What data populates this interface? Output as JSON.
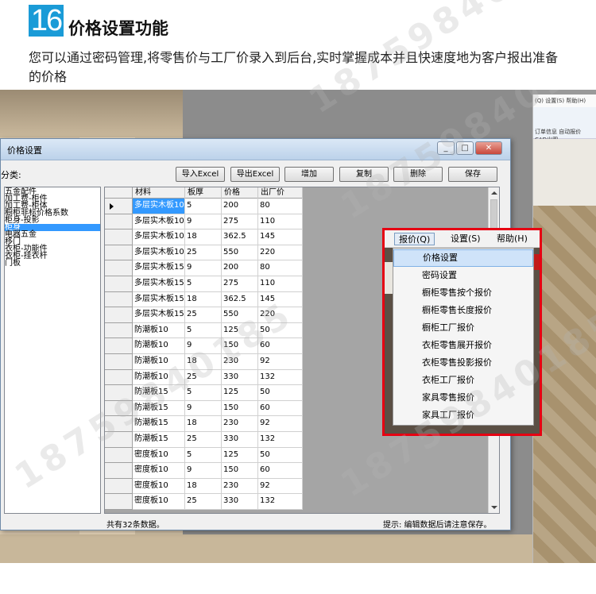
{
  "header": {
    "number": "16",
    "title": "价格设置功能",
    "description": "您可以通过密码管理,将零售价与工厂价录入到后台,实时掌握成本并且快速度地为客户报出准备的价格"
  },
  "window": {
    "title": "价格设置",
    "controls": [
      "_",
      "□",
      "✕"
    ],
    "category_label": "分类:",
    "buttons": {
      "import": "导入Excel",
      "export": "导出Excel",
      "add": "增加",
      "copy": "复制",
      "delete": "删除",
      "save": "保存"
    },
    "tree": [
      "五金配件",
      "加工费-柜件",
      "加工费-柜体",
      "橱柜非标价格系数",
      "柜身-投影",
      "柜身",
      "电器五金",
      "移门",
      "衣柜-功能件",
      "衣柜-挂衣杆",
      "门板"
    ],
    "tree_selected_index": 5,
    "columns": [
      "材料",
      "板厚",
      "价格",
      "出厂价"
    ],
    "rows": [
      [
        "多层实木板10",
        "5",
        "200",
        "80"
      ],
      [
        "多层实木板10",
        "9",
        "275",
        "110"
      ],
      [
        "多层实木板10",
        "18",
        "362.5",
        "145"
      ],
      [
        "多层实木板10",
        "25",
        "550",
        "220"
      ],
      [
        "多层实木板15",
        "9",
        "200",
        "80"
      ],
      [
        "多层实木板15",
        "5",
        "275",
        "110"
      ],
      [
        "多层实木板15",
        "18",
        "362.5",
        "145"
      ],
      [
        "多层实木板15",
        "25",
        "550",
        "220"
      ],
      [
        "防潮板10",
        "5",
        "125",
        "50"
      ],
      [
        "防潮板10",
        "9",
        "150",
        "60"
      ],
      [
        "防潮板10",
        "18",
        "230",
        "92"
      ],
      [
        "防潮板10",
        "25",
        "330",
        "132"
      ],
      [
        "防潮板15",
        "5",
        "125",
        "50"
      ],
      [
        "防潮板15",
        "9",
        "150",
        "60"
      ],
      [
        "防潮板15",
        "18",
        "230",
        "92"
      ],
      [
        "防潮板15",
        "25",
        "330",
        "132"
      ],
      [
        "密度板10",
        "5",
        "125",
        "50"
      ],
      [
        "密度板10",
        "9",
        "150",
        "60"
      ],
      [
        "密度板10",
        "18",
        "230",
        "92"
      ],
      [
        "密度板10",
        "25",
        "330",
        "132"
      ]
    ],
    "status_left": "共有32条数据。",
    "status_right": "提示: 编辑数据后请注意保存。"
  },
  "popup_menu": {
    "menubar": [
      "报价(Q)",
      "设置(S)",
      "帮助(H)"
    ],
    "items": [
      "价格设置",
      "密码设置",
      "橱柜零售按个报价",
      "橱柜零售长度报价",
      "橱柜工厂报价",
      "衣柜零售展开报价",
      "衣柜零售投影报价",
      "衣柜工厂报价",
      "家具零售报价",
      "家具工厂报价"
    ],
    "highlighted_index": 0,
    "highlight_color": "#e60012"
  },
  "right_app": {
    "menu_text": "(Q)  设置(S)  帮助(H)",
    "toolbar_text": "订单信息  自动报价  CAD出图"
  },
  "watermark": "18759840185"
}
